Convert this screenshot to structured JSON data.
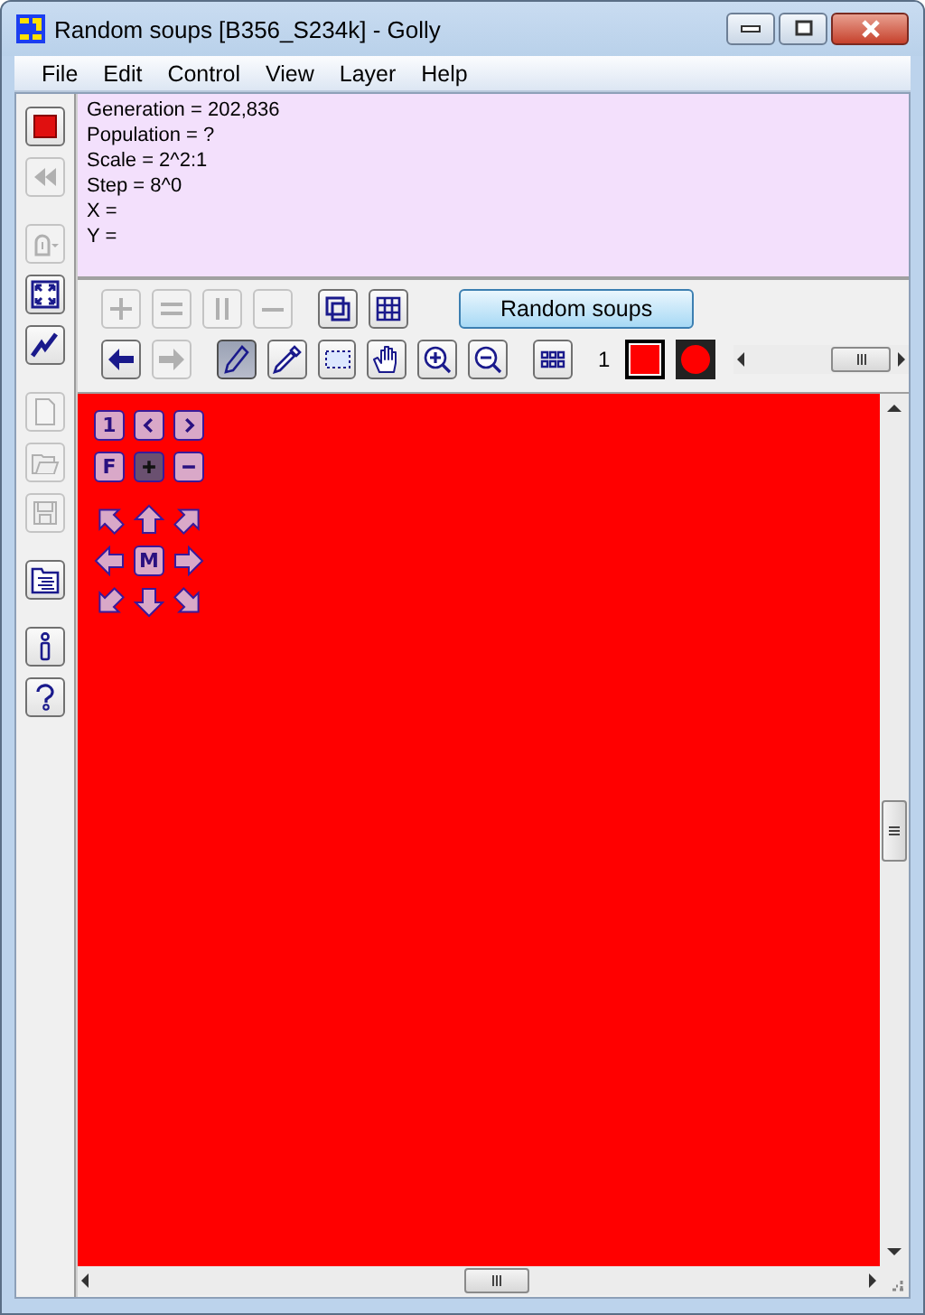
{
  "window": {
    "title": "Random soups [B356_S234k] - Golly"
  },
  "menu": [
    "File",
    "Edit",
    "Control",
    "View",
    "Layer",
    "Help"
  ],
  "sidebar": {
    "groups": [
      [
        {
          "kind": "stop",
          "disabled": false
        },
        {
          "kind": "rewind",
          "disabled": true
        }
      ],
      [
        {
          "kind": "arch",
          "disabled": true
        },
        {
          "kind": "fit",
          "disabled": false
        },
        {
          "kind": "graph",
          "disabled": false
        }
      ],
      [
        {
          "kind": "new",
          "disabled": true
        },
        {
          "kind": "open",
          "disabled": true
        },
        {
          "kind": "save",
          "disabled": true
        }
      ],
      [
        {
          "kind": "patterns",
          "disabled": false
        }
      ],
      [
        {
          "kind": "info",
          "disabled": false
        },
        {
          "kind": "help",
          "disabled": false
        }
      ]
    ]
  },
  "info": [
    "Generation = 202,836",
    "Population = ?",
    "Scale = 2^2:1",
    "Step = 8^0",
    "X =",
    "Y ="
  ],
  "toolbar": {
    "speed": [
      {
        "kind": "plus",
        "disabled": true
      },
      {
        "kind": "equals",
        "disabled": true
      },
      {
        "kind": "pause",
        "disabled": true
      },
      {
        "kind": "minus",
        "disabled": true
      }
    ],
    "view": [
      {
        "kind": "layers",
        "disabled": false
      },
      {
        "kind": "grid",
        "disabled": false
      }
    ],
    "script_button": "Random soups",
    "history": [
      {
        "kind": "back",
        "disabled": false
      },
      {
        "kind": "forward",
        "disabled": true
      }
    ],
    "tools": [
      {
        "kind": "pencil",
        "selected": true
      },
      {
        "kind": "dropper",
        "selected": false
      },
      {
        "kind": "select",
        "selected": false
      },
      {
        "kind": "hand",
        "selected": false
      },
      {
        "kind": "zoom_in",
        "selected": false
      },
      {
        "kind": "zoom_out",
        "selected": false
      }
    ],
    "layer_button": {
      "kind": "dots"
    },
    "state": "1",
    "swatches": [
      {
        "kind": "square",
        "selected": true
      },
      {
        "kind": "circle",
        "selected": false
      }
    ]
  },
  "overlay": {
    "rows": [
      [
        {
          "kind": "text",
          "label": "1",
          "selected": false
        },
        {
          "kind": "prev",
          "selected": false
        },
        {
          "kind": "next",
          "selected": false
        }
      ],
      [
        {
          "kind": "text",
          "label": "F",
          "selected": false
        },
        {
          "kind": "plus",
          "selected": true
        },
        {
          "kind": "minus",
          "selected": false
        }
      ],
      [
        {
          "kind": "nw",
          "selected": false
        },
        {
          "kind": "n",
          "selected": false
        },
        {
          "kind": "ne",
          "selected": false
        }
      ],
      [
        {
          "kind": "w",
          "selected": false
        },
        {
          "kind": "text",
          "label": "M",
          "selected": false
        },
        {
          "kind": "e",
          "selected": false
        }
      ],
      [
        {
          "kind": "sw",
          "selected": false
        },
        {
          "kind": "s",
          "selected": false
        },
        {
          "kind": "se",
          "selected": false
        }
      ]
    ]
  }
}
